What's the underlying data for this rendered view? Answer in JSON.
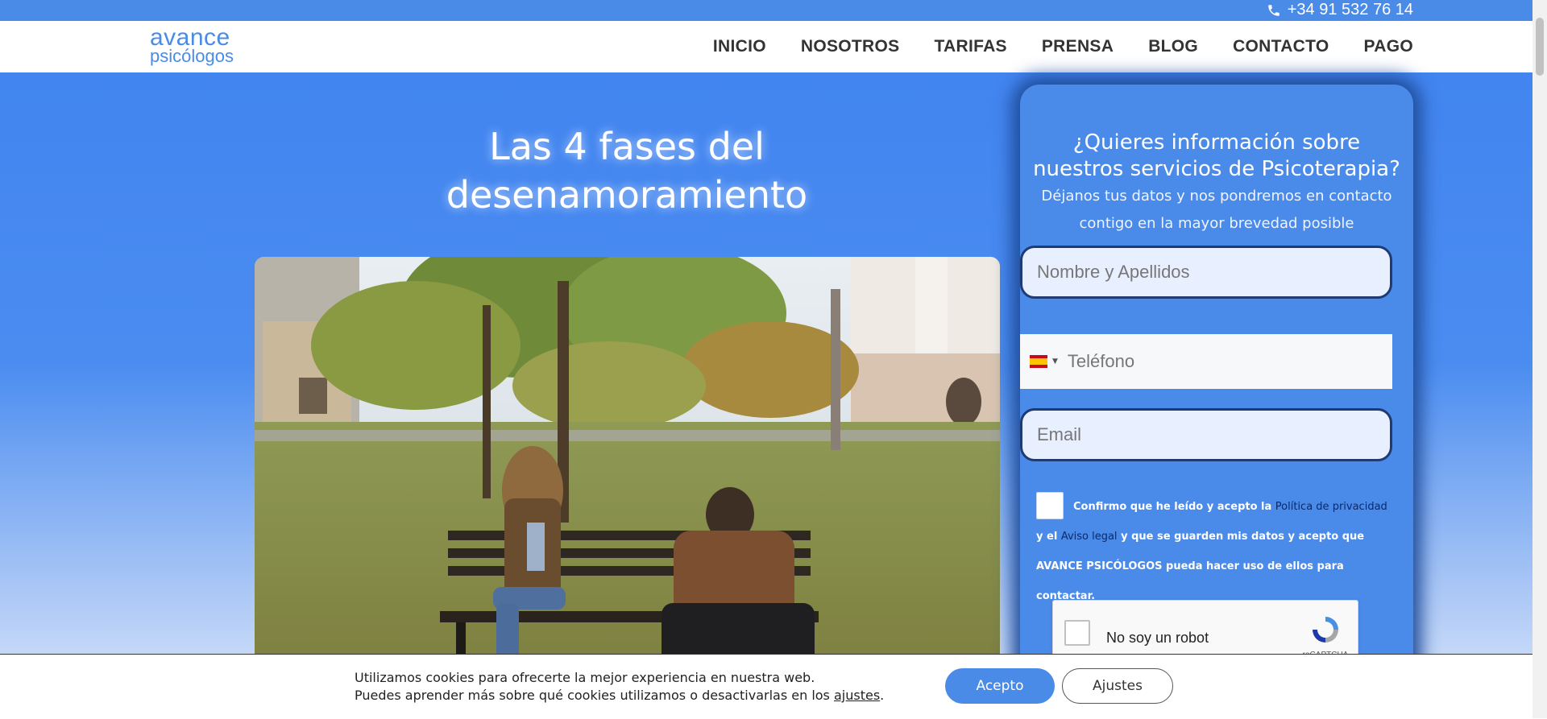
{
  "topbar": {
    "phone": "+34 91 532 76 14"
  },
  "header": {
    "logo_line1": "avance",
    "logo_line2": "psicólogos",
    "nav": [
      "INICIO",
      "NOSOTROS",
      "TARIFAS",
      "PRENSA",
      "BLOG",
      "CONTACTO",
      "PAGO"
    ]
  },
  "hero": {
    "title_line1": "Las 4 fases del",
    "title_line2": "desenamoramiento"
  },
  "form": {
    "heading_line1": "¿Quieres información sobre",
    "heading_line2": "nuestros servicios de Psicoterapia?",
    "sub_line1": "Déjanos tus datos y nos pondremos en contacto",
    "sub_line2": "contigo en la mayor brevedad posible",
    "name_placeholder": "Nombre y Apellidos",
    "phone_placeholder": "Teléfono",
    "email_placeholder": "Email",
    "consent_part1": "Confirmo que he leído y acepto la ",
    "privacy_link": "Política de privacidad",
    "consent_part2": " y el ",
    "legal_link": "Aviso legal",
    "consent_part3": " y que se guarden mis datos y acepto que AVANCE PSICÓLOGOS pueda hacer uso de ellos para contactar.",
    "captcha_label": "No soy un robot",
    "captcha_brand": "reCAPTCHA"
  },
  "cookie": {
    "line1": "Utilizamos cookies para ofrecerte la mejor experiencia en nuestra web.",
    "line2_pre": "Puedes aprender más sobre qué cookies utilizamos o desactivarlas en los ",
    "line2_link": "ajustes",
    "line2_post": ".",
    "accept": "Acepto",
    "settings": "Ajustes"
  },
  "colors": {
    "brand": "#4a8be8",
    "hero": "#4285f0",
    "link_dark": "#0b2a6b"
  },
  "icons": {
    "phone": "phone-icon",
    "flag": "spain-flag-icon",
    "recaptcha": "recaptcha-icon"
  }
}
